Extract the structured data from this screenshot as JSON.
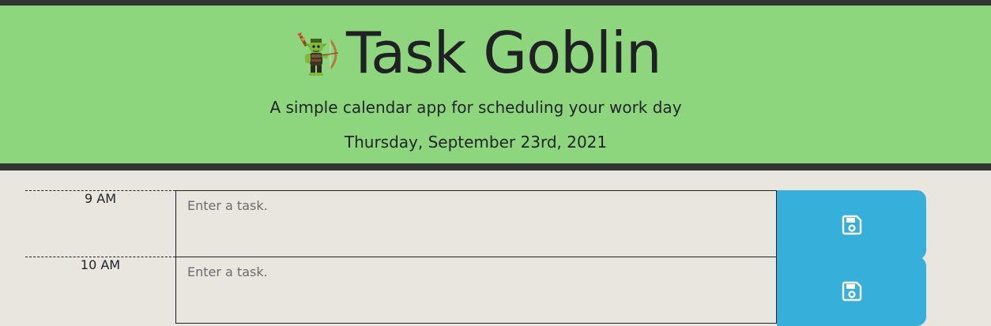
{
  "header": {
    "title": "Task Goblin",
    "tagline": "A simple calendar app for scheduling your work day",
    "current_date": "Thursday, September 23rd, 2021",
    "logo_icon": "goblin-archer-icon"
  },
  "colors": {
    "header_bg": "#8dd67d",
    "header_border": "#323432",
    "page_bg": "#e9e5df",
    "save_button": "#36afda"
  },
  "timeblocks": [
    {
      "hour": "9 AM",
      "task_value": "",
      "placeholder": "Enter a task.",
      "save_icon": "floppy-disk-icon"
    },
    {
      "hour": "10 AM",
      "task_value": "",
      "placeholder": "Enter a task.",
      "save_icon": "floppy-disk-icon"
    }
  ]
}
